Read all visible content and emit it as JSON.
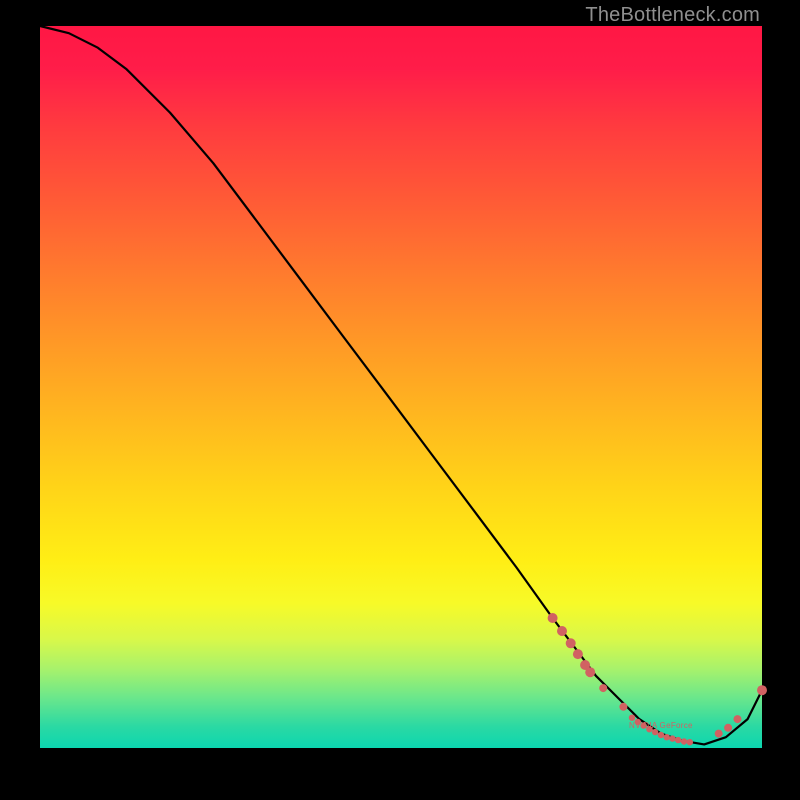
{
  "watermark": "TheBottleneck.com",
  "colors": {
    "curve": "#000000",
    "dot": "#d16262",
    "gradient_top": "#ff1744",
    "gradient_bottom": "#0cd6b0"
  },
  "chart_data": {
    "type": "line",
    "title": "",
    "xlabel": "",
    "ylabel": "",
    "xlim": [
      0,
      100
    ],
    "ylim": [
      0,
      100
    ],
    "x": [
      0,
      4,
      8,
      12,
      18,
      24,
      30,
      36,
      42,
      48,
      54,
      60,
      66,
      71,
      74,
      77,
      80,
      83,
      86,
      89,
      92,
      95,
      98,
      100
    ],
    "values": [
      100,
      99,
      97,
      94,
      88,
      81,
      73,
      65,
      57,
      49,
      41,
      33,
      25,
      18,
      14,
      10,
      7,
      4,
      2,
      1,
      0.5,
      1.5,
      4,
      8
    ],
    "marker_clusters": [
      {
        "name": "upper-segment",
        "points": [
          {
            "x": 71.0,
            "y": 18.0
          },
          {
            "x": 72.3,
            "y": 16.2
          },
          {
            "x": 73.5,
            "y": 14.5
          },
          {
            "x": 74.5,
            "y": 13.0
          },
          {
            "x": 75.5,
            "y": 11.5
          },
          {
            "x": 76.2,
            "y": 10.5
          }
        ],
        "radius": 5
      },
      {
        "name": "sparse-mid",
        "points": [
          {
            "x": 78.0,
            "y": 8.3
          },
          {
            "x": 80.8,
            "y": 5.7
          }
        ],
        "radius": 4
      },
      {
        "name": "valley-band",
        "points": [
          {
            "x": 82.0,
            "y": 4.2
          },
          {
            "x": 82.8,
            "y": 3.6
          },
          {
            "x": 83.6,
            "y": 3.1
          },
          {
            "x": 84.4,
            "y": 2.6
          },
          {
            "x": 85.2,
            "y": 2.2
          },
          {
            "x": 86.0,
            "y": 1.8
          },
          {
            "x": 86.8,
            "y": 1.5
          },
          {
            "x": 87.6,
            "y": 1.3
          },
          {
            "x": 88.4,
            "y": 1.1
          },
          {
            "x": 89.2,
            "y": 0.9
          },
          {
            "x": 90.0,
            "y": 0.8
          }
        ],
        "radius": 3.2
      },
      {
        "name": "right-rise",
        "points": [
          {
            "x": 94.0,
            "y": 2.0
          },
          {
            "x": 95.3,
            "y": 2.8
          },
          {
            "x": 96.6,
            "y": 4.0
          }
        ],
        "radius": 4
      },
      {
        "name": "end-point",
        "points": [
          {
            "x": 100.0,
            "y": 8.0
          }
        ],
        "radius": 5
      }
    ],
    "annotations": [
      {
        "text": "NVIDIA GeForce",
        "x": 86,
        "y": 2.8
      }
    ]
  }
}
